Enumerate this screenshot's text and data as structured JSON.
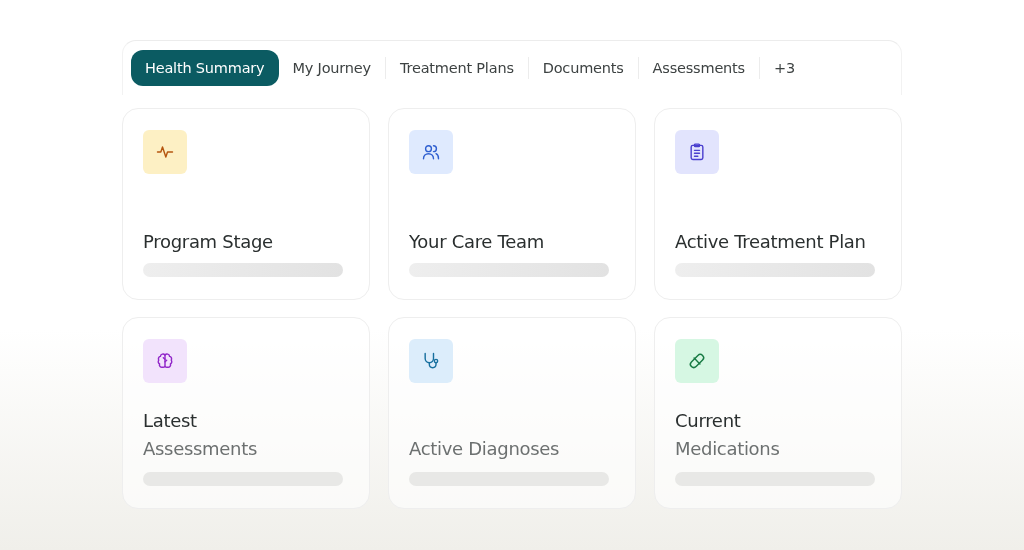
{
  "tabs": [
    {
      "label": "Health Summary",
      "selected": true
    },
    {
      "label": "My Journey",
      "selected": false
    },
    {
      "label": "Treatment Plans",
      "selected": false
    },
    {
      "label": "Documents",
      "selected": false
    },
    {
      "label": "Assessments",
      "selected": false
    },
    {
      "label": "+3",
      "selected": false
    }
  ],
  "cards": [
    {
      "title": "Program Stage",
      "color": "#fdf0c4"
    },
    {
      "title": "Your Care Team",
      "color": "#dfeafe"
    },
    {
      "title": "Active Treatment Plan",
      "color": "#e2e4fd"
    },
    {
      "title": "Latest",
      "subtitle": "Assessments",
      "color": "#f2e3fc"
    },
    {
      "subtitle": "Active Diagnoses",
      "color": "#dcedfb"
    },
    {
      "title": "Current",
      "subtitle": "Medications",
      "color": "#d6f7e3"
    }
  ]
}
